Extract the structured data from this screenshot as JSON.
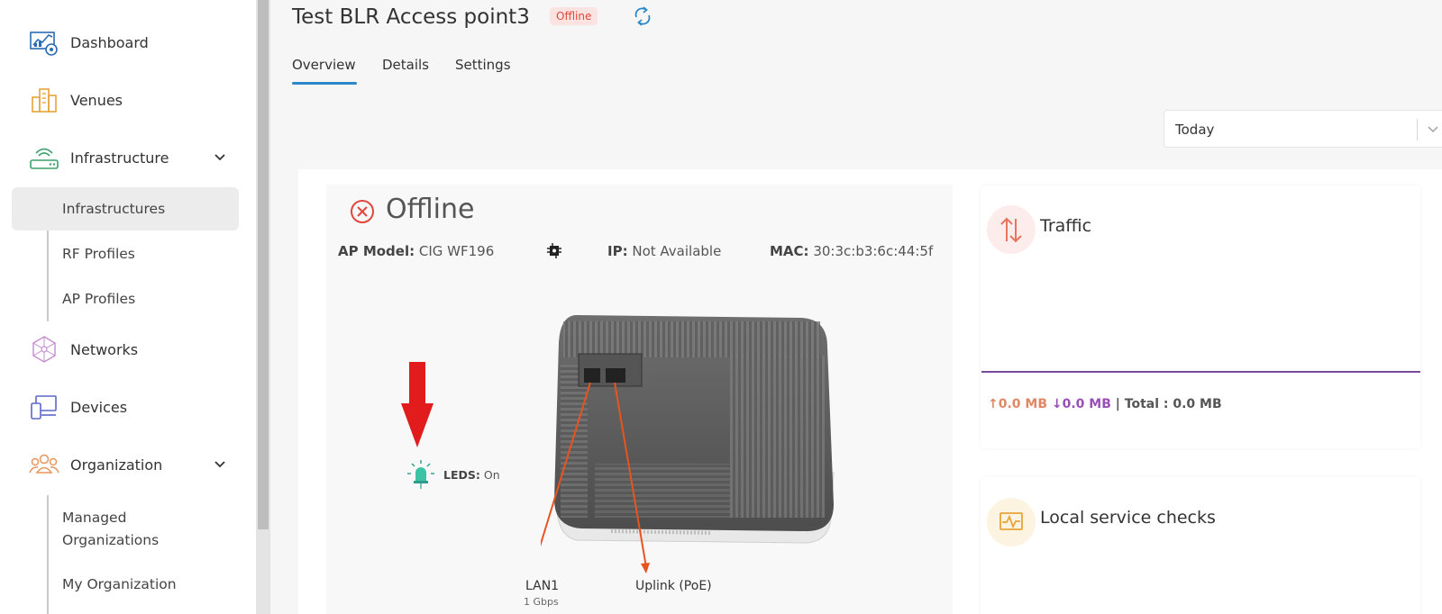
{
  "sidebar": {
    "items": [
      {
        "label": "Dashboard",
        "icon": "dashboard-icon"
      },
      {
        "label": "Venues",
        "icon": "venues-icon"
      },
      {
        "label": "Infrastructure",
        "icon": "infrastructure-icon",
        "expanded": true
      },
      {
        "label": "Networks",
        "icon": "networks-icon"
      },
      {
        "label": "Devices",
        "icon": "devices-icon"
      },
      {
        "label": "Organization",
        "icon": "organization-icon",
        "expanded": true
      }
    ],
    "infrastructure_sub": [
      "Infrastructures",
      "RF Profiles",
      "AP Profiles"
    ],
    "organization_sub": [
      "Managed Organizations",
      "My Organization"
    ],
    "active_sub": "Infrastructures"
  },
  "header": {
    "title": "Test BLR Access point3",
    "status_badge": "Offline",
    "tabs": [
      "Overview",
      "Details",
      "Settings"
    ],
    "active_tab": "Overview"
  },
  "date_filter": {
    "value": "Today"
  },
  "status": {
    "heading": "Offline",
    "ap_model_label": "AP Model:",
    "ap_model": "CIG WF196",
    "ip_label": "IP:",
    "ip": "Not Available",
    "mac_label": "MAC:",
    "mac": "30:3c:b3:6c:44:5f",
    "leds_label": "LEDS:",
    "leds": "On",
    "ports": [
      {
        "label": "LAN1",
        "sub": "1 Gbps"
      },
      {
        "label": "Uplink (PoE)",
        "sub": ""
      }
    ]
  },
  "traffic": {
    "title": "Traffic",
    "up": "↑0.0 MB",
    "down": "↓0.0 MB",
    "total": "| Total : 0.0 MB"
  },
  "local_service_checks": {
    "title": "Local service checks"
  },
  "colors": {
    "accent": "#2b88c8",
    "offline": "#e0473d",
    "traffic_line": "#7b4b9b"
  }
}
